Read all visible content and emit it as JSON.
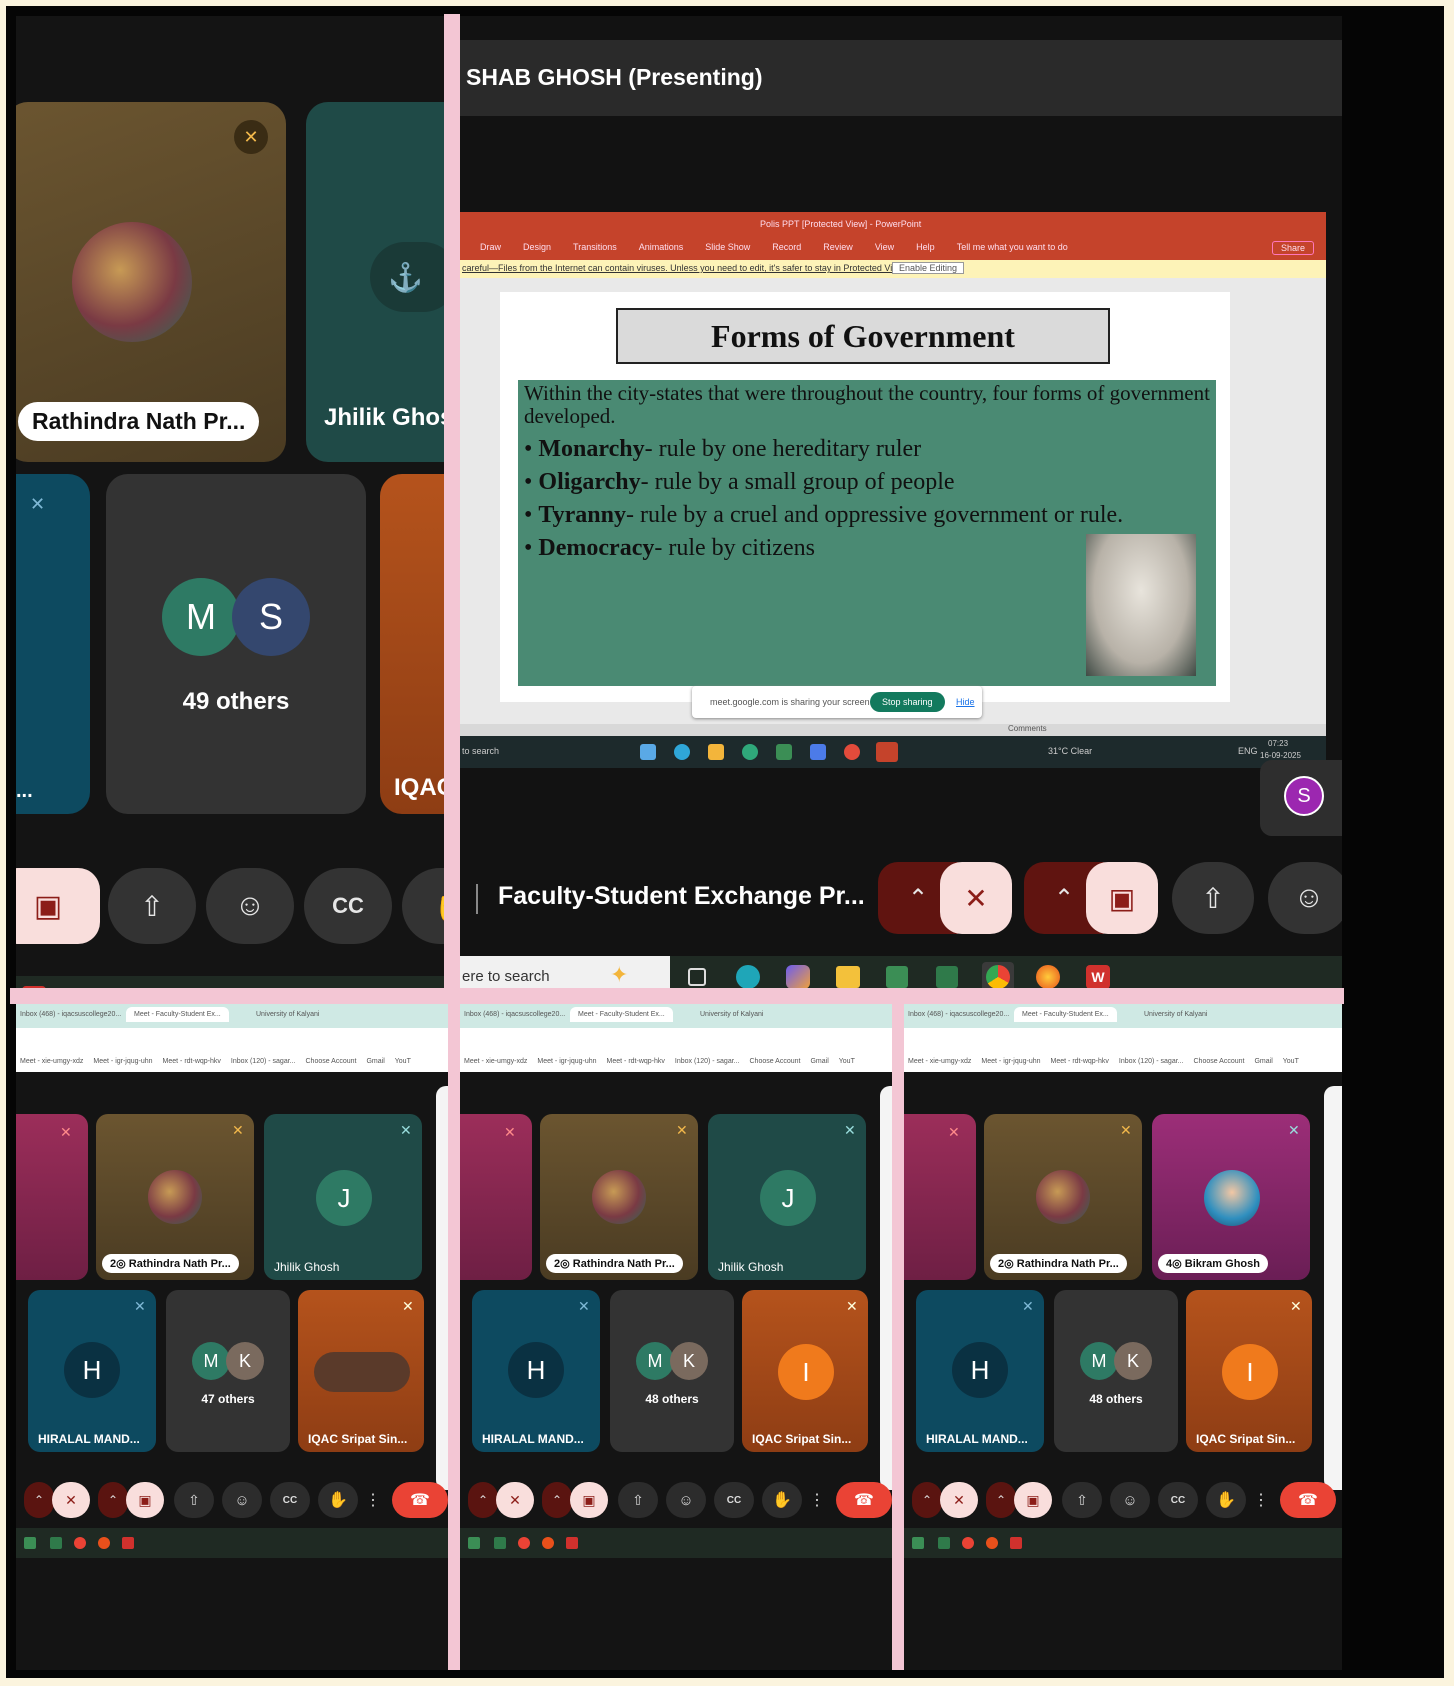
{
  "top_left": {
    "tiles": [
      {
        "name": "Rathindra Nath Pr..."
      },
      {
        "name": "Jhilik Ghosh"
      },
      {
        "name": "IQAC S"
      }
    ],
    "others": {
      "initials": [
        "M",
        "S"
      ],
      "label": "49 others"
    }
  },
  "presenter": {
    "title": "SHAB GHOSH (Presenting)",
    "meeting_name": "Faculty-Student Exchange Pr...",
    "self_initial": "S",
    "self_initial_2": "S"
  },
  "powerpoint": {
    "title": "Polis PPT [Protected View] - PowerPoint",
    "tabs": [
      "Draw",
      "Design",
      "Transitions",
      "Animations",
      "Slide Show",
      "Record",
      "Review",
      "View",
      "Help"
    ],
    "tell_me": "Tell me what you want to do",
    "share": "Share",
    "protected_msg": "careful—Files from the Internet can contain viruses. Unless you need to edit, it's safer to stay in Protected View.",
    "enable_editing": "Enable Editing",
    "sharing_msg": "meet.google.com is sharing your screen.",
    "stop_sharing": "Stop sharing",
    "hide": "Hide",
    "comments": "Comments",
    "search": "to search",
    "weather": "31°C Clear",
    "lang": "ENG",
    "time": "07:23",
    "date": "16-09-2025"
  },
  "slide": {
    "title": "Forms of Government",
    "intro": "Within the city-states that were throughout the country, four forms of government developed.",
    "bullets": [
      {
        "term": "Monarchy",
        "desc": "- rule by one hereditary ruler"
      },
      {
        "term": "Oligarchy",
        "desc": "- rule by a small group of people"
      },
      {
        "term": "Tyranny",
        "desc": "- rule by a cruel and oppressive government or rule."
      },
      {
        "term": "Democracy",
        "desc": "- rule by citizens"
      }
    ]
  },
  "taskbar": {
    "search": "ere to search"
  },
  "bottom_panels": [
    {
      "tabs": [
        "Inbox (468) - iqacsuscollege20...",
        "Meet - Faculty-Student Ex...",
        "University of Kalyani"
      ],
      "bookmarks": [
        "Meet - xie-umgy-xdz",
        "Meet - igr-jqug-uhn",
        "Meet - rdt-wqp-hkv",
        "Inbox (120) - sagar...",
        "Choose Account",
        "Gmail",
        "YouT"
      ],
      "tile1_name": "Rathindra Nath Pr...",
      "tile1_count": "2",
      "tile2_name": "Jhilik Ghosh",
      "tile2_initial": "J",
      "h_initial": "H",
      "h_name": "HIRALAL MAND...",
      "others_label": "47 others",
      "others_initials": [
        "M",
        "K"
      ],
      "iqac_name": "IQAC Sripat Sin...",
      "iqac_initial": ""
    },
    {
      "tabs": [
        "Inbox (468) - iqacsuscollege20...",
        "Meet - Faculty-Student Ex...",
        "University of Kalyani"
      ],
      "bookmarks": [
        "Meet - xie-umgy-xdz",
        "Meet - igr-jqug-uhn",
        "Meet - rdt-wqp-hkv",
        "Inbox (120) - sagar...",
        "Choose Account",
        "Gmail",
        "YouT"
      ],
      "tile1_name": "Rathindra Nath Pr...",
      "tile1_count": "2",
      "tile2_name": "Jhilik Ghosh",
      "tile2_initial": "J",
      "h_initial": "H",
      "h_name": "HIRALAL MAND...",
      "others_label": "48 others",
      "others_initials": [
        "M",
        "K"
      ],
      "iqac_name": "IQAC Sripat Sin...",
      "iqac_initial": "I"
    },
    {
      "tabs": [
        "Inbox (468) - iqacsuscollege20...",
        "Meet - Faculty-Student Ex...",
        "University of Kalyani"
      ],
      "bookmarks": [
        "Meet - xie-umgy-xdz",
        "Meet - igr-jqug-uhn",
        "Meet - rdt-wqp-hkv",
        "Inbox (120) - sagar...",
        "Choose Account",
        "Gmail",
        "YouT"
      ],
      "tile1_name": "Rathindra Nath Pr...",
      "tile1_count": "2",
      "tile2_name": "Bikram Ghosh",
      "tile2_count": "4",
      "tile2_initial": "",
      "h_initial": "H",
      "h_name": "HIRALAL MAND...",
      "others_label": "48 others",
      "others_initials": [
        "M",
        "K"
      ],
      "iqac_name": "IQAC Sripat Sin...",
      "iqac_initial": "I"
    }
  ],
  "colors": {
    "meet_bg": "#141414",
    "accent_red": "#ea4335",
    "mute_pink": "#f9dedc",
    "slide_green": "#4a8a73"
  }
}
